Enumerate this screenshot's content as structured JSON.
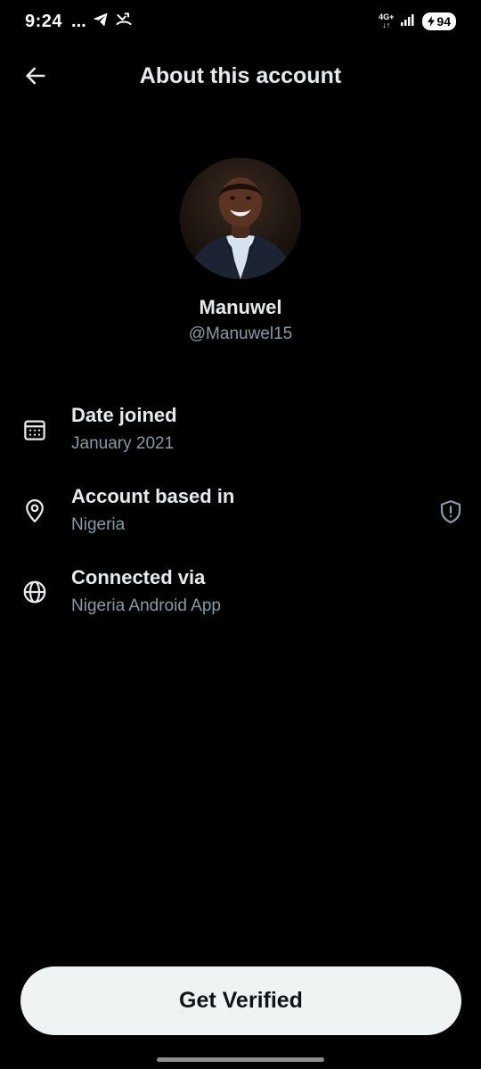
{
  "status_bar": {
    "time": "9:24",
    "dots": "...",
    "network": "4G+",
    "battery": "94"
  },
  "header": {
    "title": "About this account"
  },
  "profile": {
    "name": "Manuwel",
    "handle": "@Manuwel15"
  },
  "details": [
    {
      "icon": "calendar-icon",
      "title": "Date joined",
      "value": "January 2021"
    },
    {
      "icon": "location-pin-icon",
      "title": "Account based in",
      "value": "Nigeria"
    },
    {
      "icon": "globe-icon",
      "title": "Connected via",
      "value": "Nigeria Android App"
    }
  ],
  "verify_button": {
    "label": "Get Verified"
  },
  "colors": {
    "background": "#000000",
    "primary_text": "#e7e9ea",
    "secondary_text": "#8b98a5",
    "button_bg": "#eff3f4",
    "button_text": "#0f1419"
  }
}
